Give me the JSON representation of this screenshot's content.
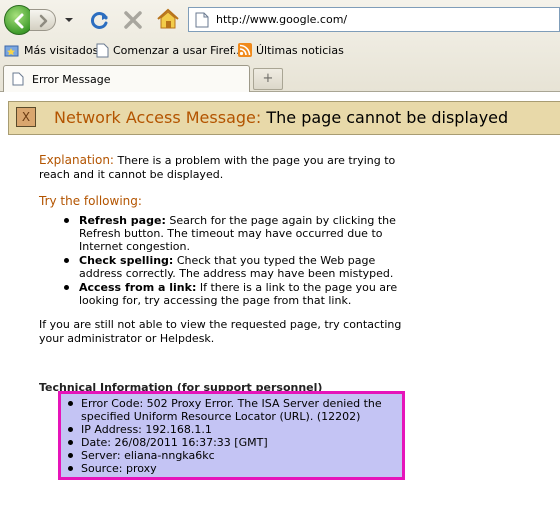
{
  "browser": {
    "url": "http://www.google.com/",
    "tab_title": "Error Message",
    "new_tab_symbol": "+",
    "bookmarks": [
      {
        "label": "Más visitados",
        "icon": "bookmarks-folder-icon"
      },
      {
        "label": "Comenzar a usar Firef...",
        "icon": "page-icon"
      },
      {
        "label": "Últimas noticias",
        "icon": "rss-feed-icon"
      }
    ],
    "colors": {
      "back_green": "#3f9c2b",
      "reload_blue": "#2c6ec0",
      "home_yellow": "#e6b628"
    }
  },
  "page": {
    "banner": {
      "x_symbol": "X",
      "label": "Network Access Message:",
      "message": "The page cannot be displayed",
      "background": "#e8d9a9",
      "accent": "#b35400"
    },
    "explanation": {
      "heading": "Explanation:",
      "text": "There is a problem with the page you are trying to reach and it cannot be displayed."
    },
    "try_following": {
      "heading": "Try the following:",
      "items": [
        {
          "title": "Refresh page:",
          "text": "Search for the page again by clicking the Refresh button. The timeout may have occurred due to Internet congestion."
        },
        {
          "title": "Check spelling:",
          "text": "Check that you typed the Web page address correctly. The address may have been mistyped."
        },
        {
          "title": "Access from a link:",
          "text": "If there is a link to the page you are looking for, try accessing the page from that link."
        }
      ]
    },
    "contact_text": "If you are still not able to view the requested page, try contacting your administrator or Helpdesk.",
    "technical": {
      "heading": "Technical Information (for support personnel)",
      "items": [
        "Error Code: 502 Proxy Error. The ISA Server denied the specified Uniform Resource Locator (URL). (12202)",
        "IP Address: 192.168.1.1",
        "Date: 26/08/2011 16:37:33 [GMT]",
        "Server: eliana-nngka6kc",
        "Source: proxy"
      ],
      "highlight_border": "#e614ba",
      "highlight_fill": "#c4c4f4"
    }
  }
}
